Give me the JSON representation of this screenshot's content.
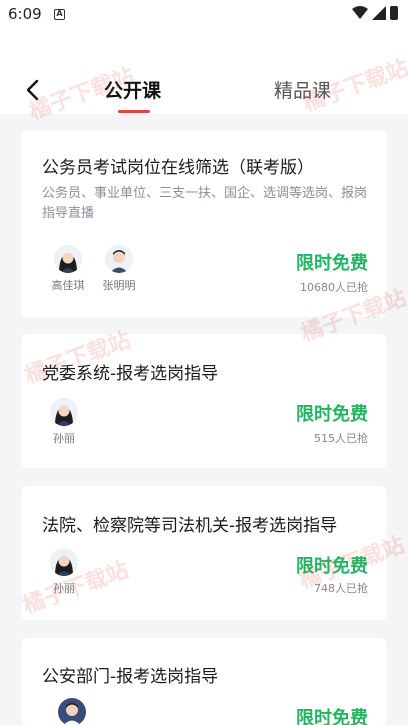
{
  "status": {
    "time": "6:09",
    "app_icon": "A"
  },
  "header": {
    "tabs": [
      {
        "label": "公开课",
        "active": true
      },
      {
        "label": "精品课",
        "active": false
      }
    ]
  },
  "courses": [
    {
      "title": "公务员考试岗位在线筛选（联考版）",
      "desc": "公务员、事业单位、三支一扶、国企、选调等选岗、报岗指导直播",
      "teachers": [
        "高佳琪",
        "张明明"
      ],
      "price_label": "限时免费",
      "count": "10680人已抢"
    },
    {
      "title": "党委系统-报考选岗指导",
      "teachers": [
        "孙丽"
      ],
      "price_label": "限时免费",
      "count": "515人已抢"
    },
    {
      "title": "法院、检察院等司法机关-报考选岗指导",
      "teachers": [
        "孙丽"
      ],
      "price_label": "限时免费",
      "count": "748人已抢"
    },
    {
      "title": "公安部门-报考选岗指导",
      "price_label": "限时免费"
    }
  ],
  "watermark": "橘子下载站",
  "colors": {
    "accent_red": "#e5443a",
    "free_green": "#24b562",
    "bg": "#f4f5f7"
  }
}
